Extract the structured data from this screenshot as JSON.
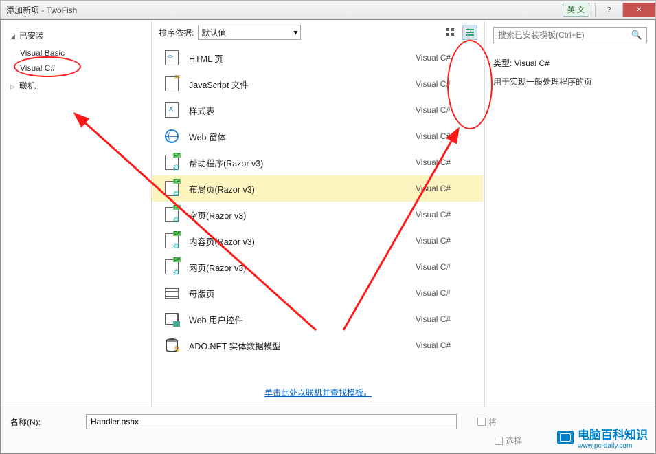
{
  "window": {
    "title": "添加新项 - TwoFish",
    "ime": "英 文"
  },
  "tree": {
    "installed": "已安装",
    "items": [
      "Visual Basic",
      "Visual C#"
    ],
    "online": "联机",
    "selected_index": 1
  },
  "toolbar": {
    "sort_label": "排序依据:",
    "sort_value": "默认值"
  },
  "templates": [
    {
      "name": "HTML 页",
      "lang": "Visual C#",
      "icon": "ico-html",
      "cs": false
    },
    {
      "name": "JavaScript 文件",
      "lang": "Visual C#",
      "icon": "ico-js",
      "cs": false
    },
    {
      "name": "样式表",
      "lang": "Visual C#",
      "icon": "ico-css",
      "cs": false
    },
    {
      "name": "Web 窗体",
      "lang": "Visual C#",
      "icon": "ico-globe",
      "cs": false
    },
    {
      "name": "帮助程序(Razor v3)",
      "lang": "Visual C#",
      "icon": "ico-doc at",
      "cs": true
    },
    {
      "name": "布局页(Razor v3)",
      "lang": "Visual C#",
      "icon": "ico-doc at",
      "cs": true,
      "selected": true
    },
    {
      "name": "空页(Razor v3)",
      "lang": "Visual C#",
      "icon": "ico-doc at",
      "cs": true
    },
    {
      "name": "内容页(Razor v3)",
      "lang": "Visual C#",
      "icon": "ico-doc at",
      "cs": true
    },
    {
      "name": "网页(Razor v3)",
      "lang": "Visual C#",
      "icon": "ico-doc at",
      "cs": true
    },
    {
      "name": "母版页",
      "lang": "Visual C#",
      "icon": "ico-grid",
      "cs": false
    },
    {
      "name": "Web 用户控件",
      "lang": "Visual C#",
      "icon": "ico-box",
      "cs": false
    },
    {
      "name": "ADO.NET 实体数据模型",
      "lang": "Visual C#",
      "icon": "ico-db",
      "cs": false
    }
  ],
  "online_link": "单击此处以联机并查找模板。",
  "search": {
    "placeholder": "搜索已安装模板(Ctrl+E)"
  },
  "info": {
    "type_label": "类型:",
    "type_value": "Visual C#",
    "desc": "用于实现一般处理程序的页"
  },
  "bottom": {
    "name_label": "名称(N):",
    "name_value": "Handler.ashx",
    "cb1": "将",
    "cb2": "选择"
  },
  "watermark": {
    "text": "电脑百科知识",
    "url": "www.pc-daily.com"
  }
}
